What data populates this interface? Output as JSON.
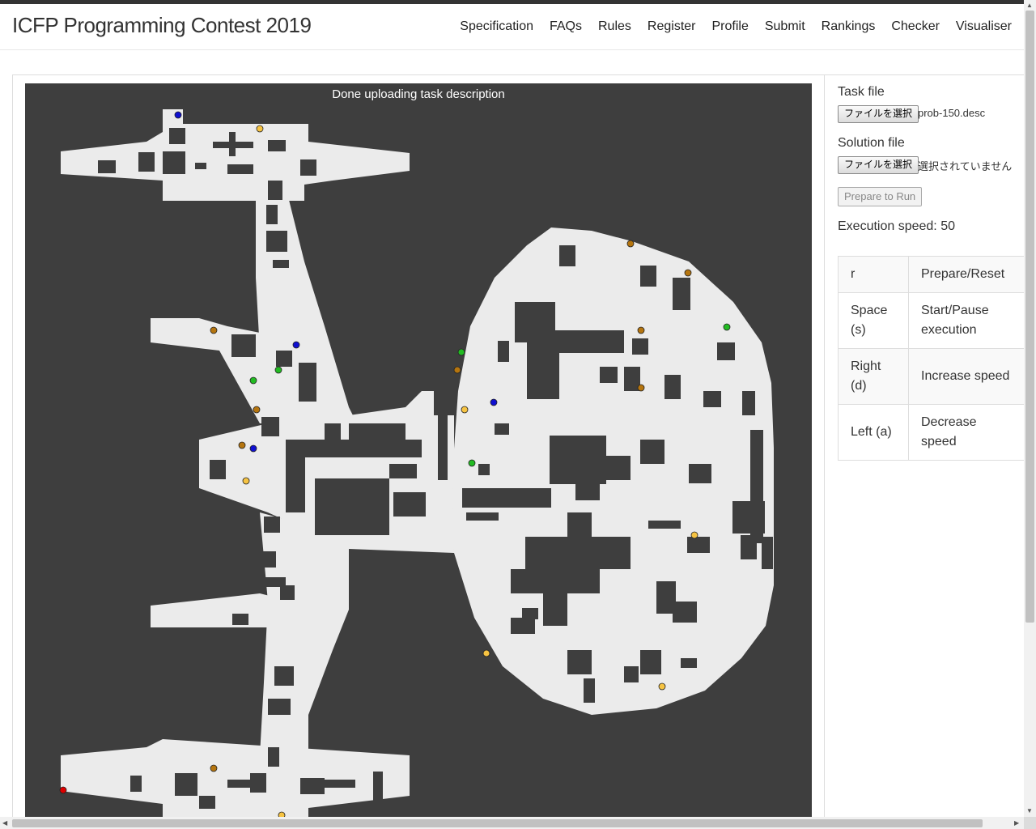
{
  "brand": "ICFP Programming Contest 2019",
  "nav": [
    "Specification",
    "FAQs",
    "Rules",
    "Register",
    "Profile",
    "Submit",
    "Rankings",
    "Checker",
    "Visualiser"
  ],
  "canvas": {
    "status": "Done uploading task description"
  },
  "task_file": {
    "label": "Task file",
    "button": "ファイルを選択",
    "value": "prob-150.desc"
  },
  "solution_file": {
    "label": "Solution file",
    "button": "ファイルを選択",
    "value": "選択されていません"
  },
  "run_button": "Prepare to Run",
  "speed": "Execution speed: 50",
  "keys": [
    {
      "key": "r",
      "action": "Prepare/Reset"
    },
    {
      "key": "Space (s)",
      "action": "Start/Pause execution"
    },
    {
      "key": "Right (d)",
      "action": "Increase speed"
    },
    {
      "key": "Left (a)",
      "action": "Decrease speed"
    }
  ],
  "colors": {
    "wall": "#3e3e3e",
    "floor": "#ebebeb",
    "robot": "#e00000",
    "booster_blue": "#1010d0",
    "booster_yellow": "#f6c342",
    "booster_brown": "#b5750f",
    "booster_green": "#22bb22"
  }
}
